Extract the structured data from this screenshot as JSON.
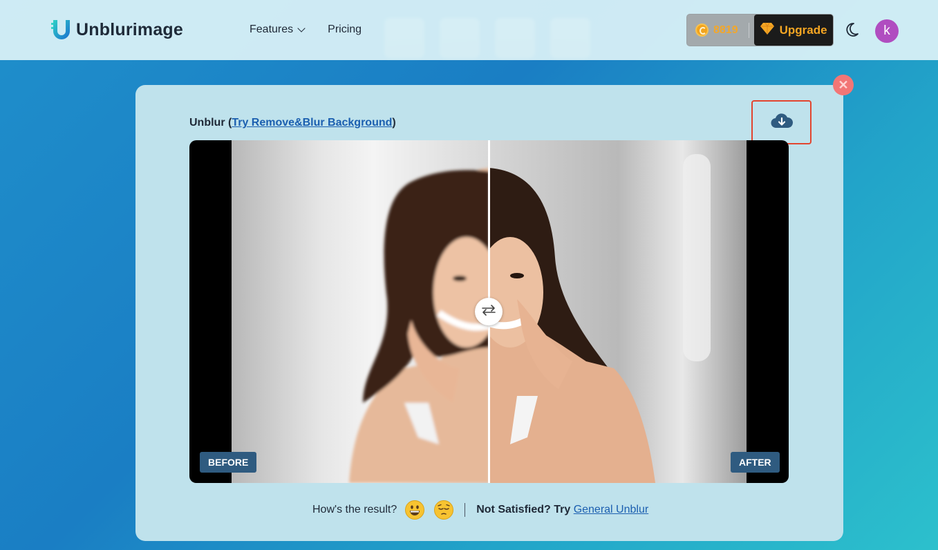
{
  "header": {
    "brand": "Unblurimage",
    "nav": [
      {
        "label": "Features"
      },
      {
        "label": "Pricing"
      }
    ],
    "credits": "8819",
    "upgrade_label": "Upgrade",
    "avatar_letter": "k"
  },
  "card": {
    "title_prefix": "Unblur (",
    "title_link": "Try Remove&Blur Background",
    "title_suffix": ")",
    "before_label": "BEFORE",
    "after_label": "AFTER",
    "feedback_question": "How's the result?",
    "not_satisfied_prefix": "Not Satisfied? Try ",
    "not_satisfied_link": "General Unblur"
  },
  "colors": {
    "accent_link": "#1b5fb0",
    "upgrade_text": "#f5a623",
    "close_button": "#f27676",
    "avatar": "#b04dc0",
    "highlight_box": "#e2452f"
  },
  "icons": [
    "logo-mark-icon",
    "chevron-down-icon",
    "coin-icon",
    "diamond-icon",
    "moon-icon",
    "close-icon",
    "cloud-download-icon",
    "swap-arrows-icon",
    "grinning-emoji-icon",
    "pensive-emoji-icon"
  ]
}
